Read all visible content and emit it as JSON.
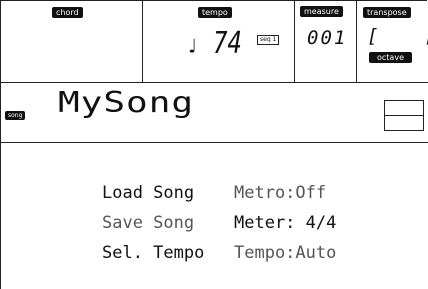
{
  "header": {
    "chord_label": "chord",
    "tempo_label": "tempo",
    "tempo_note": "♩",
    "tempo_value": "74",
    "tempo_badge": "seq 1",
    "measure_label": "measure",
    "measure_value": "001",
    "transpose_label": "transpose",
    "transpose_value": "[    [",
    "octave_label": "octave"
  },
  "song": {
    "badge": "song",
    "name": "MySong"
  },
  "menu": {
    "left": [
      "Load Song",
      "Save Song",
      "Sel.  Tempo"
    ],
    "right": [
      "Metro:Off",
      "Meter:  4/4",
      "Tempo:Auto"
    ]
  }
}
